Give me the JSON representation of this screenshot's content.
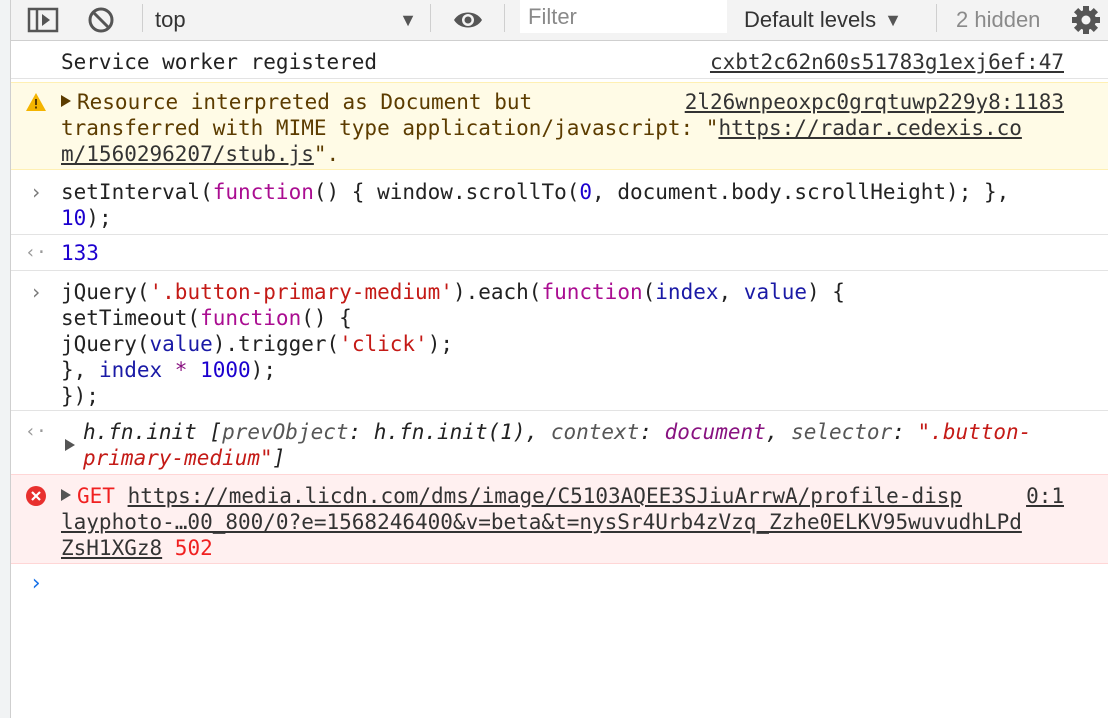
{
  "toolbar": {
    "context": "top",
    "filter_placeholder": "Filter",
    "levels": "Default levels",
    "hidden": "2 hidden"
  },
  "messages": {
    "info": {
      "text": "Service worker registered",
      "source": "cxbt2c62n60s51783g1exj6ef:47"
    },
    "warning": {
      "source": "2l26wnpeoxpc0grqtuwp229y8:1183",
      "line1": "Resource interpreted as Document but",
      "line2_prefix": "transferred with MIME type application/javascript: \"",
      "url_part1": "https://radar.cedexis.co",
      "url_part2": "m/1560296207/stub.js",
      "line3_suffix": "\"."
    },
    "input1": {
      "l1_a": "setInterval(",
      "l1_kw": "function",
      "l1_b": "() { window.scrollTo(",
      "l1_num": "0",
      "l1_c": ", document.body.scrollHeight); },",
      "l2_num": "10",
      "l2_rest": ");"
    },
    "result1": {
      "value": "133"
    },
    "input2": {
      "l1_a": "jQuery(",
      "l1_str": "'.button-primary-medium'",
      "l1_b": ").each(",
      "l1_kw": "function",
      "l1_c": "(",
      "l1_p1": "index",
      "l1_d": ", ",
      "l1_p2": "value",
      "l1_e": ") {",
      "l2_a": "setTimeout(",
      "l2_kw": "function",
      "l2_b": "() {",
      "l3_a": "jQuery(",
      "l3_p": "value",
      "l3_b": ").trigger(",
      "l3_str": "'click'",
      "l3_c": ");",
      "l4_a": "}, ",
      "l4_p": "index",
      "l4_op": " * ",
      "l4_num": "1000",
      "l4_b": ");",
      "l5": "});"
    },
    "result2": {
      "l1_a": "h.fn.init [",
      "l1_k1": "prevObject",
      "l1_b": ": h.fn.init(1), ",
      "l1_k2": "context",
      "l1_c": ": ",
      "l1_v2": "document",
      "l1_d": ", ",
      "l1_k3": "selector",
      "l1_e": ": ",
      "l1_s1": "\".button-",
      "l2_s2": "primary-medium\"",
      "l2_end": "]"
    },
    "error": {
      "method": "GET ",
      "source": "0:1",
      "url_l1": "https://media.licdn.com/dms/image/C5103AQEE3SJiuArrwA/profile-disp",
      "url_l2": "layphoto-…00_800/0?e=1568246400&v=beta&t=nysSr4Urb4zVzq_Zzhe0ELKV95wuvudhLPd",
      "url_l3": "ZsH1XGz8",
      "status": " 502"
    }
  },
  "colors": {
    "warning_bg": "#fffbe6",
    "error_bg": "#fff0f0",
    "error_text": "#f02020",
    "keyword": "#aa0d91",
    "number": "#1c00cf",
    "string": "#c41a16",
    "prompt": "#1a73e8"
  }
}
